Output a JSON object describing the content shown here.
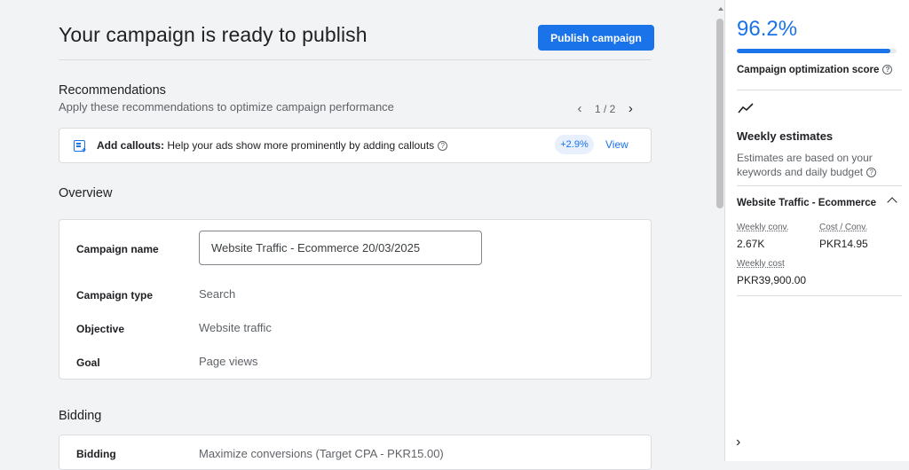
{
  "header": {
    "title": "Your campaign is ready to publish",
    "publish_label": "Publish campaign"
  },
  "recommendations": {
    "heading": "Recommendations",
    "subtitle": "Apply these recommendations to optimize campaign performance",
    "page_indicator": "1 / 2",
    "item": {
      "title": "Add callouts:",
      "description": "Help your ads show more prominently by adding callouts",
      "uplift": "+2.9%",
      "view_label": "View"
    }
  },
  "overview": {
    "heading": "Overview",
    "campaign_name_label": "Campaign name",
    "campaign_name_value": "Website Traffic - Ecommerce 20/03/2025",
    "campaign_type_label": "Campaign type",
    "campaign_type_value": "Search",
    "objective_label": "Objective",
    "objective_value": "Website traffic",
    "goal_label": "Goal",
    "goal_value": "Page views"
  },
  "bidding": {
    "heading": "Bidding",
    "label": "Bidding",
    "value": "Maximize conversions (Target CPA - PKR15.00)"
  },
  "sidebar": {
    "score": "96.2%",
    "score_fraction": 0.962,
    "score_label": "Campaign optimization score",
    "weekly_title": "Weekly estimates",
    "weekly_subtitle": "Estimates are based on your keywords and daily budget",
    "traffic_title": "Website Traffic - Ecommerce",
    "weekly_conv_label": "Weekly conv.",
    "weekly_conv_value": "2.67K",
    "cost_conv_label": "Cost / Conv.",
    "cost_conv_value": "PKR14.95",
    "weekly_cost_label": "Weekly cost",
    "weekly_cost_value": "PKR39,900.00"
  },
  "colors": {
    "accent": "#1a73e8",
    "badge_bg": "#e8f0fe"
  },
  "icons": [
    "callout-add-icon",
    "help-icon",
    "chevron-left-icon",
    "chevron-right-icon",
    "trend-line-icon",
    "chevron-up-icon",
    "scroll-up-icon"
  ]
}
